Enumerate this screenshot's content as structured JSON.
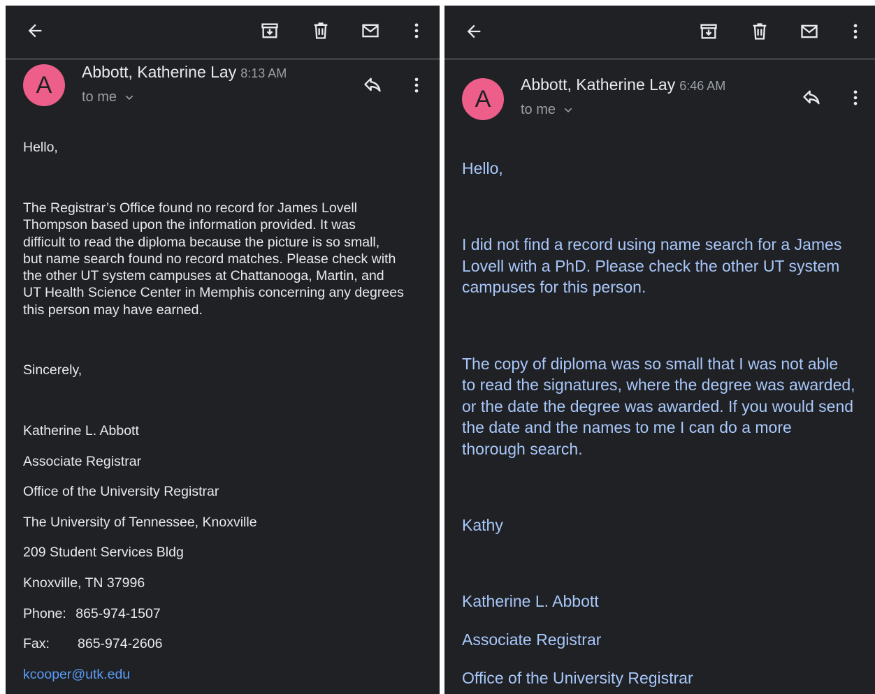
{
  "left": {
    "sender_name": "Abbott, Katherine Lay",
    "time": "8:13 AM",
    "recipient": "to me",
    "avatar_letter": "A",
    "greeting": "Hello,",
    "paragraph_lines": [
      "The Registrar’s Office found no record for James Lovell",
      "Thompson based upon the information provided. It was",
      "difficult to read the diploma because the picture is so small,",
      "but name search found no record matches. Please check with",
      "the other UT system campuses at Chattanooga, Martin, and",
      "UT Health Science Center in Memphis concerning any degrees",
      "this person may have earned."
    ],
    "closing": "Sincerely,",
    "signature": [
      "Katherine L. Abbott",
      "Associate Registrar",
      "Office of the University Registrar",
      "The University of Tennessee, Knoxville",
      "209 Student Services Bldg",
      "Knoxville, TN  37996"
    ],
    "phone_label": "Phone:",
    "phone": "865-974-1507",
    "fax_label": "Fax:",
    "fax": "865-974-2606",
    "email": "kcooper@utk.edu"
  },
  "right": {
    "sender_name": "Abbott, Katherine Lay",
    "time": "6:46 AM",
    "recipient": "to me",
    "avatar_letter": "A",
    "greeting": "Hello,",
    "paragraph1_lines": [
      "I did not find a record using name search for a James",
      "Lovell with a PhD. Please check the other UT system",
      "campuses for this person."
    ],
    "paragraph2_lines": [
      "The copy of diploma was so small that I was not able",
      "to read the signatures, where the degree was awarded,",
      "or the date the degree was awarded. If you would send",
      "the date and the names to me I can do a more",
      "thorough search."
    ],
    "signoff": "Kathy",
    "signature": [
      "Katherine L. Abbott",
      "Associate Registrar",
      "Office of the University Registrar"
    ]
  },
  "colors": {
    "background": "#202124",
    "avatar": "#ee5e8a",
    "text": "#e8eaed",
    "muted": "#9aa0a6",
    "right_body_text": "#a8c7fa",
    "link": "#5b9cf6"
  },
  "icons": [
    "back-arrow-icon",
    "archive-icon",
    "delete-icon",
    "mark-unread-icon",
    "more-vert-icon",
    "reply-icon",
    "chevron-down-icon"
  ]
}
